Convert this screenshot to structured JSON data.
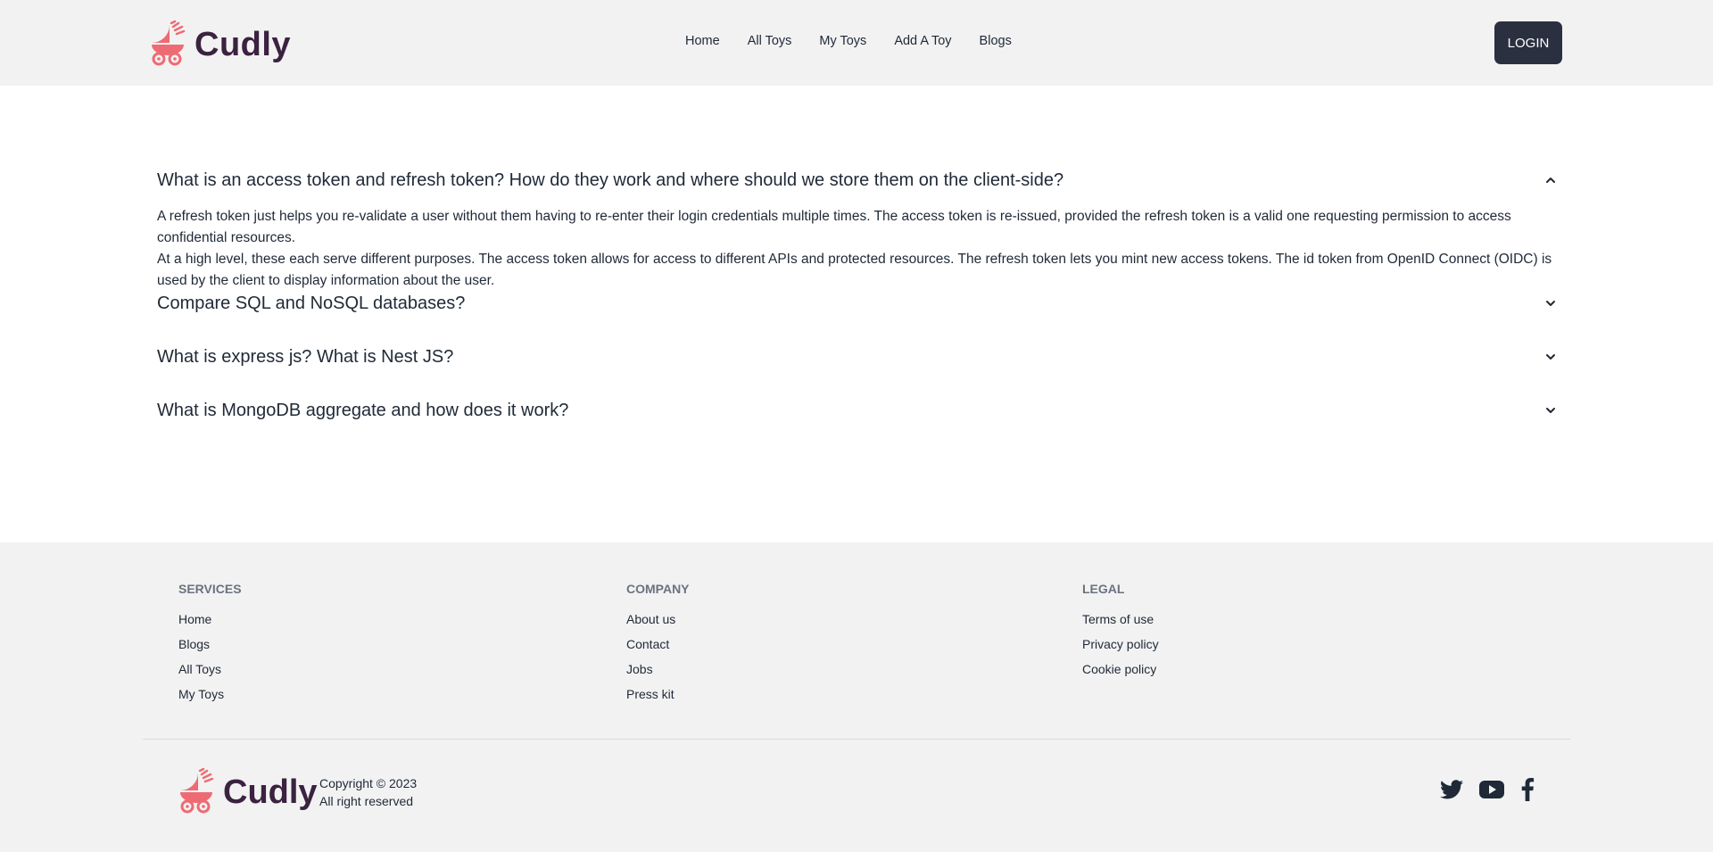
{
  "brand": {
    "name": "Cudly",
    "accent": "#ee6b73",
    "dark": "#3b2240"
  },
  "nav": {
    "items": [
      "Home",
      "All Toys",
      "My Toys",
      "Add A Toy",
      "Blogs"
    ],
    "login": "LOGIN"
  },
  "faq": [
    {
      "question": "What is an access token and refresh token? How do they work and where should we store them on the client-side?",
      "open": true,
      "answer": [
        "A refresh token just helps you re-validate a user without them having to re-enter their login credentials multiple times. The access token is re-issued, provided the refresh token is a valid one requesting permission to access confidential resources.",
        "At a high level, these each serve different purposes. The access token allows for access to different APIs and protected resources. The refresh token lets you mint new access tokens. The id token from OpenID Connect (OIDC) is used by the client to display information about the user."
      ]
    },
    {
      "question": "Compare SQL and NoSQL databases?",
      "open": false
    },
    {
      "question": "What is express js? What is Nest JS?",
      "open": false
    },
    {
      "question": "What is MongoDB aggregate and how does it work?",
      "open": false
    }
  ],
  "footer": {
    "columns": [
      {
        "title": "SERVICES",
        "links": [
          "Home",
          "Blogs",
          "All Toys",
          "My Toys"
        ]
      },
      {
        "title": "COMPANY",
        "links": [
          "About us",
          "Contact",
          "Jobs",
          "Press kit"
        ]
      },
      {
        "title": "LEGAL",
        "links": [
          "Terms of use",
          "Privacy policy",
          "Cookie policy"
        ]
      }
    ],
    "copyright": "Copyright © 2023",
    "rights": "All right reserved",
    "social": [
      "twitter-icon",
      "youtube-icon",
      "facebook-icon"
    ]
  }
}
